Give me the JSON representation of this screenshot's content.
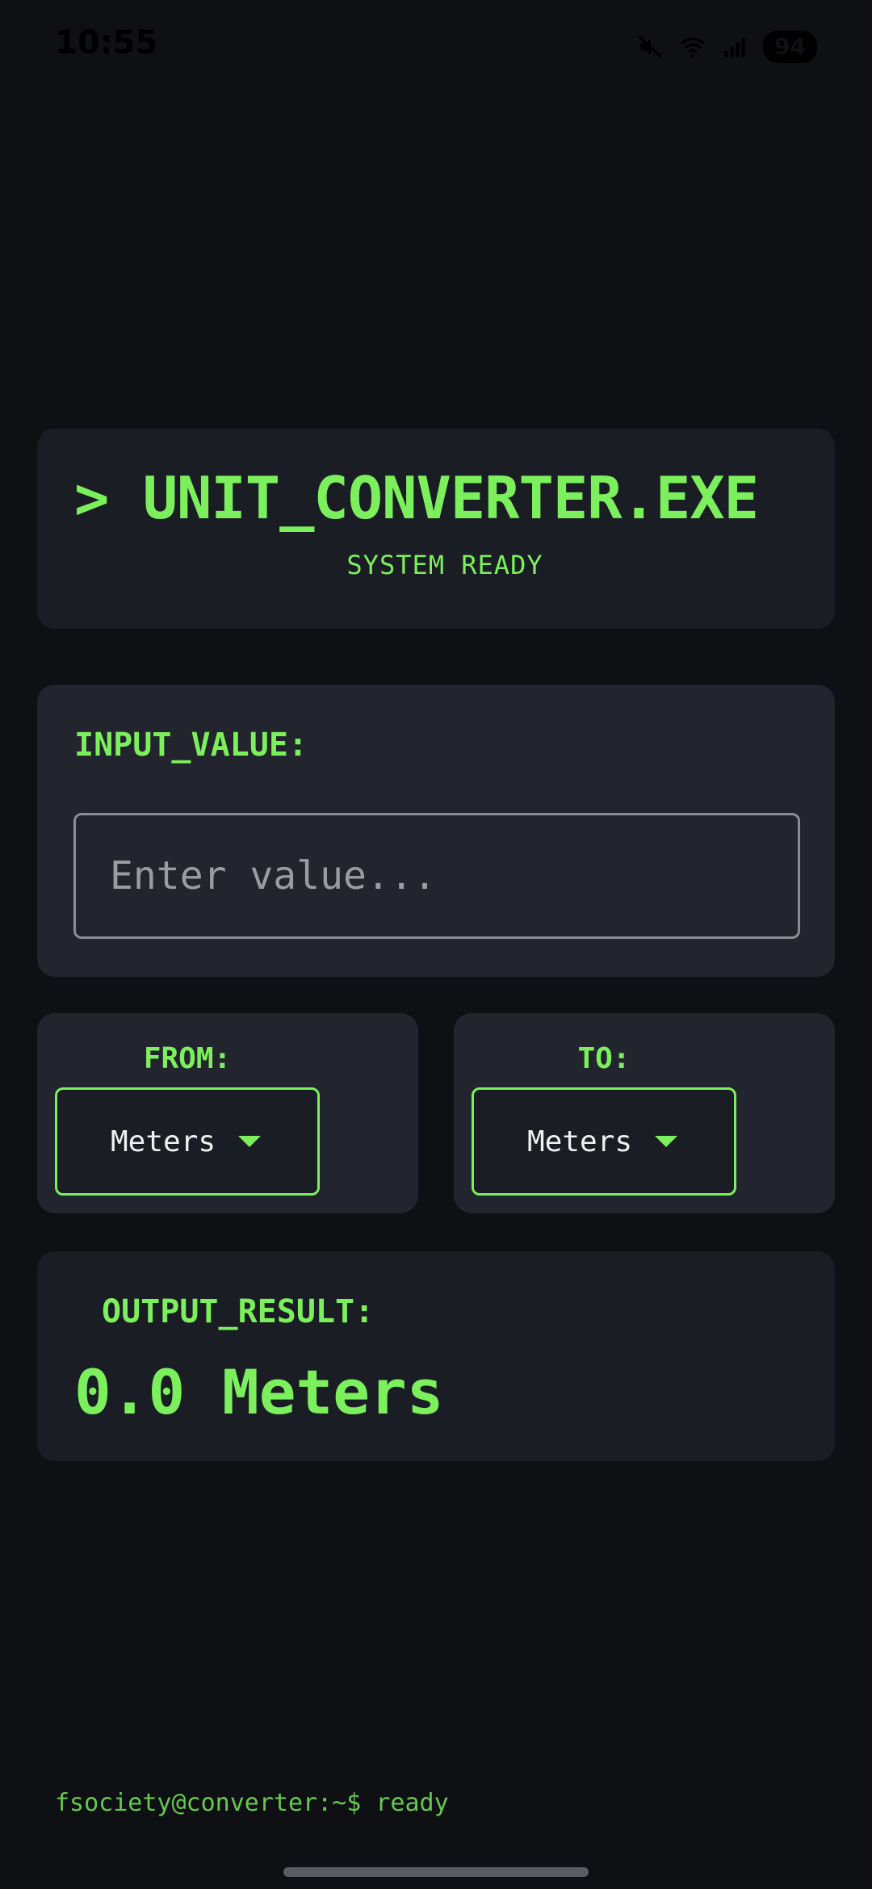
{
  "status_bar": {
    "time": "10:55",
    "battery": "94",
    "icons": [
      "mute-icon",
      "wifi-icon",
      "signal-icon"
    ]
  },
  "header": {
    "title": "> UNIT_CONVERTER.EXE",
    "subtitle": "SYSTEM READY"
  },
  "input": {
    "label": "INPUT_VALUE:",
    "value": "",
    "placeholder": "Enter value..."
  },
  "from": {
    "label": "FROM:",
    "selected": "Meters"
  },
  "to": {
    "label": "TO:",
    "selected": "Meters"
  },
  "output": {
    "label": "OUTPUT_RESULT:",
    "value": "0.0 Meters"
  },
  "terminal": {
    "prompt": "fsociety@converter:~$ ready"
  },
  "colors": {
    "background": "#0e1014",
    "accent": "#7cf05c",
    "card_dark": "#1a1d24",
    "card_light": "#22252d"
  }
}
